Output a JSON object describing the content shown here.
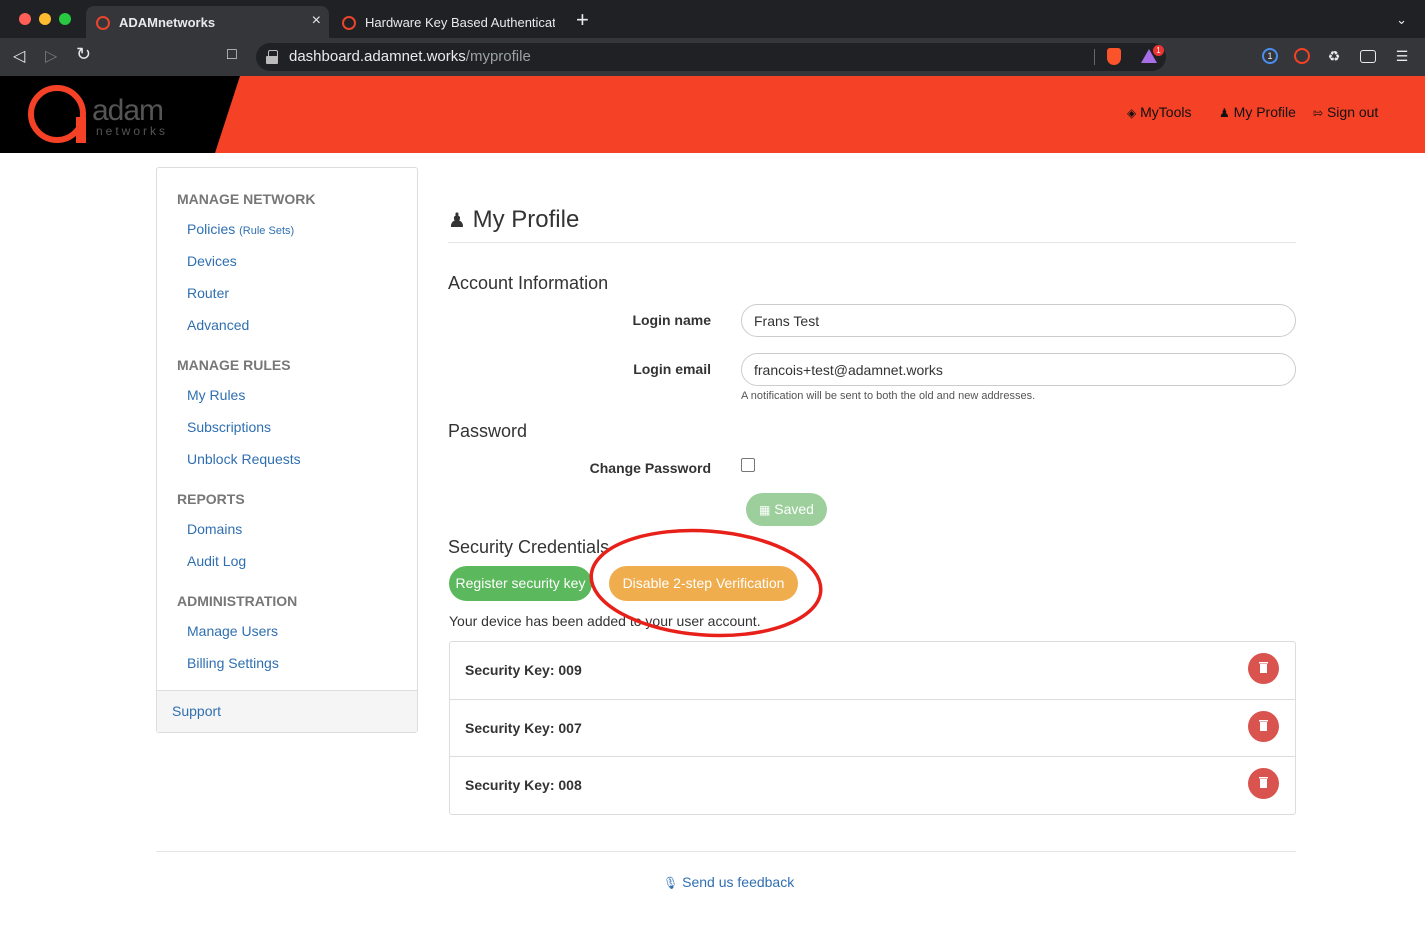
{
  "browser": {
    "tabs": [
      {
        "title": "ADAMnetworks",
        "active": true
      },
      {
        "title": "Hardware Key Based Authentication",
        "active": false
      }
    ],
    "url_host": "dashboard.adamnet.works",
    "url_path": "/myprofile",
    "extension_badge": "1"
  },
  "header": {
    "logo_text": "adam",
    "logo_sub": "networks",
    "nav": {
      "mytools": "MyTools",
      "myprofile": "My Profile",
      "signout": "Sign out"
    }
  },
  "sidebar": {
    "manage_network": "MANAGE NETWORK",
    "policies": "Policies",
    "policies_note": "(Rule Sets)",
    "devices": "Devices",
    "router": "Router",
    "advanced": "Advanced",
    "manage_rules": "MANAGE RULES",
    "my_rules": "My Rules",
    "subscriptions": "Subscriptions",
    "unblock_requests": "Unblock Requests",
    "reports": "REPORTS",
    "domains": "Domains",
    "audit_log": "Audit Log",
    "administration": "ADMINISTRATION",
    "manage_users": "Manage Users",
    "billing_settings": "Billing Settings",
    "support": "Support"
  },
  "main": {
    "title": "My Profile",
    "account_heading": "Account Information",
    "login_name_label": "Login name",
    "login_name_value": "Frans Test",
    "login_email_label": "Login email",
    "login_email_value": "francois+test@adamnet.works",
    "email_help": "A notification will be sent to both the old and new addresses.",
    "password_heading": "Password",
    "change_password_label": "Change Password",
    "saved_label": "Saved",
    "security_heading": "Security Credentials",
    "register_label": "Register security key",
    "disable_label": "Disable 2-step Verification",
    "device_message": "Your device has been added to your user account.",
    "keys": [
      "Security Key: 009",
      "Security Key: 007",
      "Security Key: 008"
    ]
  },
  "footer": {
    "feedback": "Send us feedback"
  },
  "colors": {
    "brand": "#f54126",
    "link": "#2f6fb1",
    "success": "#5cb85c",
    "warning": "#f0ad4e",
    "danger": "#d9534f",
    "annotation": "#e8201a"
  }
}
